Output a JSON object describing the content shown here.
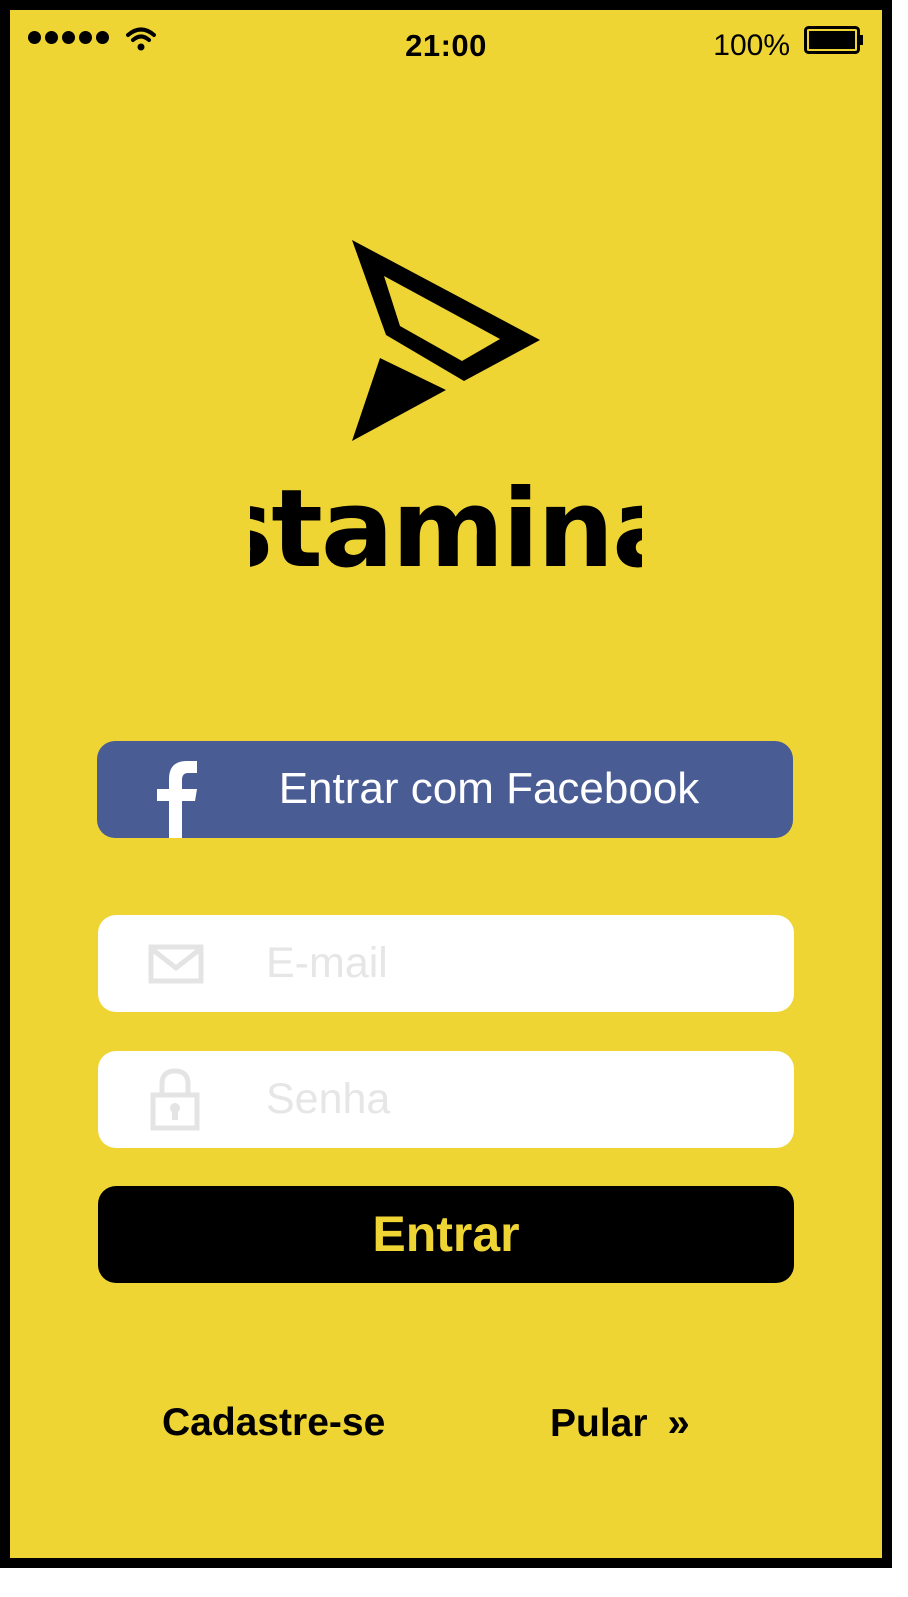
{
  "status_bar": {
    "time": "21:00",
    "battery_percent": "100%",
    "icons": [
      "signal-dots-icon",
      "wifi-icon",
      "battery-icon"
    ]
  },
  "brand": {
    "name": "stamina",
    "logo_icon": "paper-plane-arrow-icon",
    "background_color": "#efd534",
    "text_color": "#000000"
  },
  "login": {
    "facebook_button_label": "Entrar com Facebook",
    "facebook_icon": "facebook-icon",
    "facebook_color": "#4a5c94",
    "email": {
      "value": "",
      "placeholder": "E-mail",
      "icon": "envelope-icon"
    },
    "password": {
      "value": "",
      "placeholder": "Senha",
      "icon": "lock-icon"
    },
    "submit_label": "Entrar"
  },
  "footer": {
    "signup_label": "Cadastre-se",
    "skip_label": "Pular",
    "skip_icon_glyph": "»"
  }
}
